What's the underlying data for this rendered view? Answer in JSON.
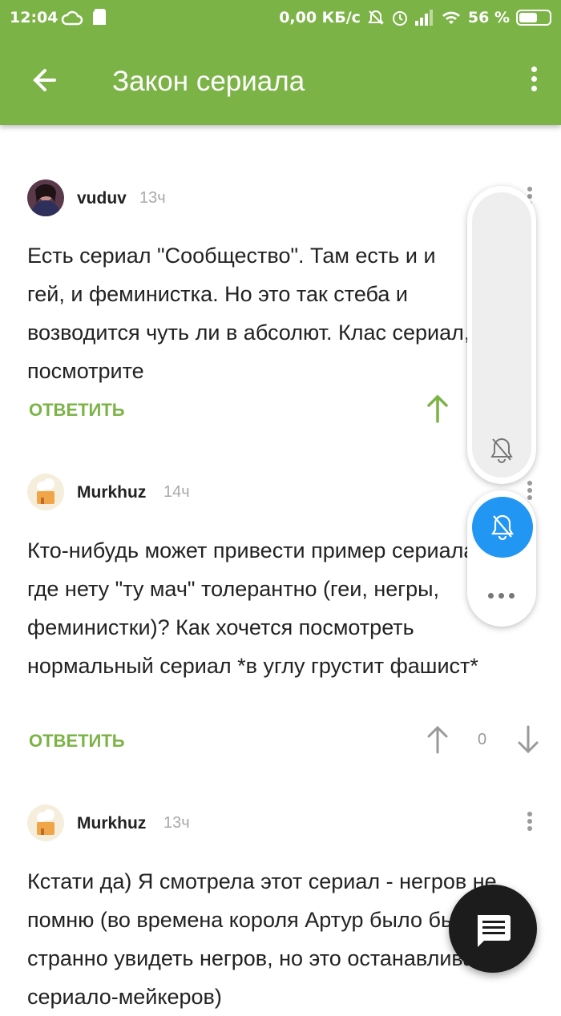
{
  "status_bar": {
    "time": "12:04",
    "speed": "0,00 КБ/с",
    "battery": "56 %",
    "battery_level": 0.56
  },
  "app_bar": {
    "title": "Закон сериала",
    "back_icon": "arrow-left-icon",
    "menu_icon": "more-vertical-icon"
  },
  "comments": [
    {
      "author": "vuduv",
      "time": "13ч",
      "text": "Есть сериал \"Сообщество\". Там есть и и гей, и феминистка. Но это так стеба и возводится чуть ли в абсолют. Клас сериал, посмотрите",
      "reply": "ОТВЕТИТЬ"
    },
    {
      "author": "Murkhuz",
      "time": "14ч",
      "text": "Кто-нибудь может привести пример сериала, где нету \"ту мач\" толерантно (геи, негры, феминистки)? Как хочется посмотреть нормальный сериал *в углу грустит фашист*",
      "reply": "ОТВЕТИТЬ",
      "votes": "0"
    },
    {
      "author": "Murkhuz",
      "time": "13ч",
      "text": "Кстати да) Я смотрела этот сериал - негров не помню (во времена короля Артур было бы странно увидеть негров, но это останавливало сериало-мейкеров)"
    }
  ],
  "floating": {
    "bell_off_icon": "bell-off-icon",
    "more_icon": "more-horizontal-icon"
  },
  "fab": {
    "icon": "comment-icon"
  },
  "colors": {
    "accent": "#7cb347",
    "blue": "#2196f3",
    "fab": "#1c1c1c"
  }
}
